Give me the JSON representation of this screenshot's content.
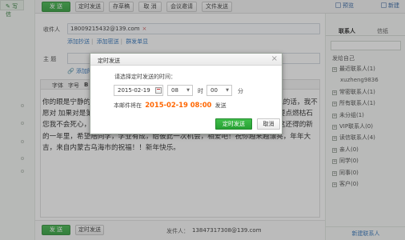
{
  "sidebar": {
    "write_label": "写信"
  },
  "toolbar": {
    "send": "发 送",
    "timed_send": "定时发送",
    "save_draft": "存草稿",
    "close": "取 消",
    "meeting": "会议邀请",
    "file_send": "文件发送",
    "preview": "预览",
    "new": "新建"
  },
  "compose": {
    "recipient_label": "收件人",
    "recipient_chip": "18009215432@139.com",
    "recipient_links": [
      "添加抄送",
      "添加密送",
      "群发单显"
    ],
    "subject_label": "主  题",
    "attach_label": "添加附件",
    "editor_tools": [
      "字体",
      "字号",
      "B",
      "A"
    ],
    "body": "你的眼是宁静的湖泊，我愿意化身为一只小鱼，在你的湖泊中游泳，我想对你说的话，我不愿对 加果对是第……的眼泪，我在你的掌心里面挣扎……即使是燃尽了，我也要点燃枯石您我不会死心，别叫我 ……啊……你的容颜……我……而……。你认……我们这还得的新的一年里，希望陪同学，学业有成，给彼此一次机会，相爱吧！祝你越来越漂亮，年年大吉，来自内蒙古乌海市的祝福！！新年快乐。",
    "sender_label": "发件人：",
    "sender": "13847317308@139.com",
    "bottom_send": "发 送",
    "bottom_timed": "定时发送"
  },
  "contacts": {
    "tabs": [
      "联系人",
      "信纸"
    ],
    "section": "发给自己",
    "items": [
      {
        "label": "最近联系人(1)",
        "sub": false
      },
      {
        "label": "xuzheng9836",
        "sub": true
      },
      {
        "label": "常密联系人(1)",
        "sub": false
      },
      {
        "label": "所有联系人(1)",
        "sub": false
      },
      {
        "label": "未分组(1)",
        "sub": false
      },
      {
        "label": "VIP联系人(0)",
        "sub": false
      },
      {
        "label": "读信联系人(4)",
        "sub": false
      },
      {
        "label": "亲人(0)",
        "sub": false
      },
      {
        "label": "同学(0)",
        "sub": false
      },
      {
        "label": "同事(0)",
        "sub": false
      },
      {
        "label": "客户(0)",
        "sub": false
      }
    ],
    "new_contact": "新建联系人"
  },
  "dialog": {
    "title": "定时发送",
    "prompt": "请选择定时发送的时间：",
    "date": "2015-02-19",
    "hour": "08",
    "hour_unit": "时",
    "minute": "00",
    "minute_unit": "分",
    "summary_prefix": "本邮件将在",
    "summary_time": "2015-02-19 08:00",
    "summary_suffix": "发送",
    "confirm": "定时发送",
    "cancel": "取消"
  },
  "colors": {
    "accent_green": "#2ba336",
    "highlight_orange": "#ff6600",
    "link_blue": "#2a6fb8"
  }
}
